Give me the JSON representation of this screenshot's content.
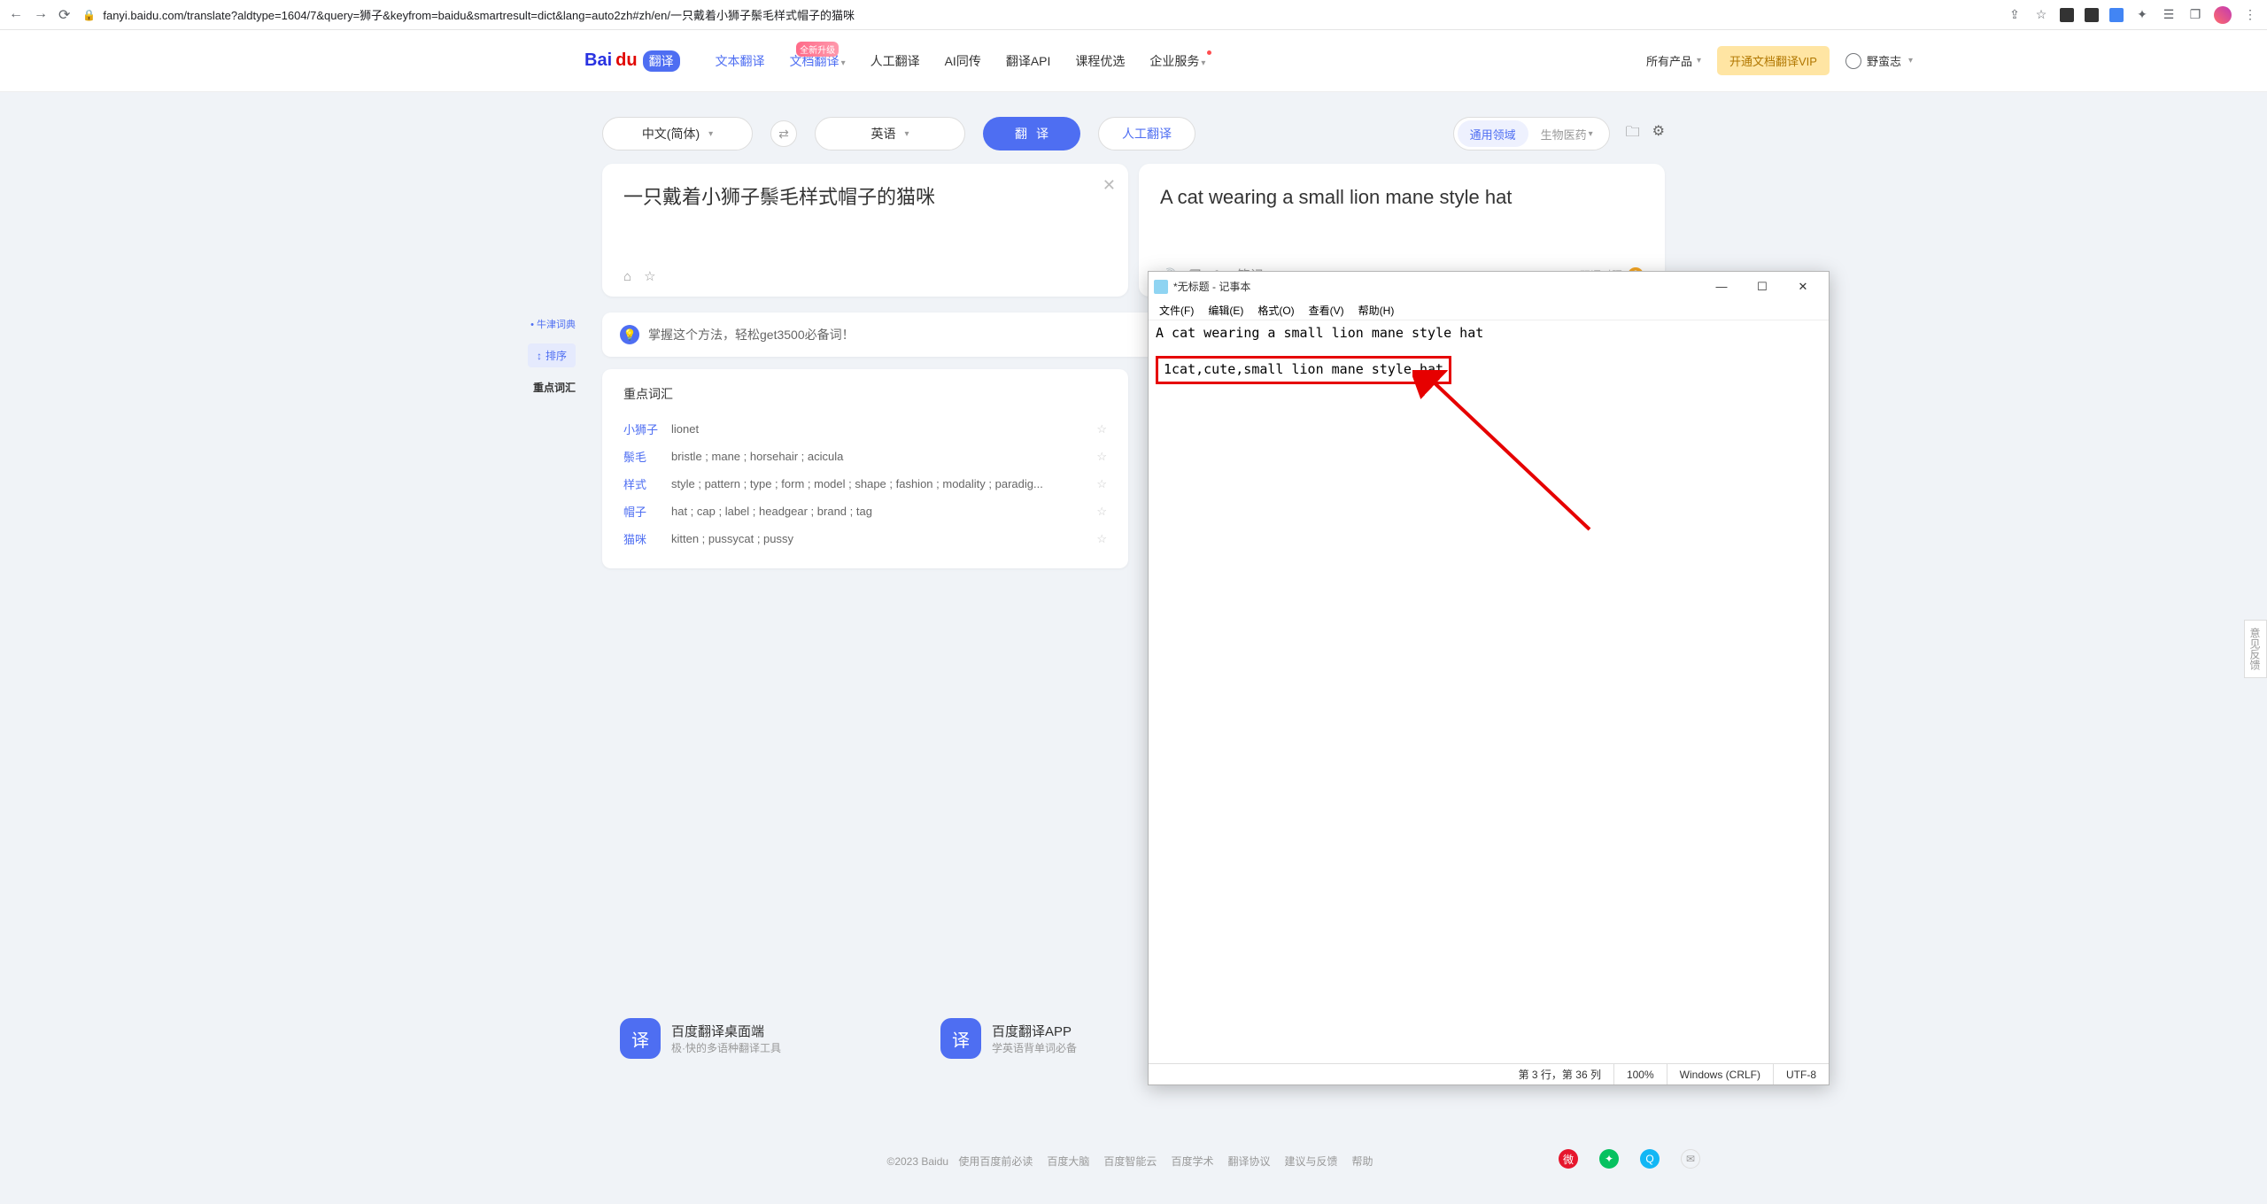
{
  "browser": {
    "url": "fanyi.baidu.com/translate?aldtype=1604/7&query=狮子&keyfrom=baidu&smartresult=dict&lang=auto2zh#zh/en/一只戴着小狮子鬃毛样式帽子的猫咪"
  },
  "header": {
    "logo_left": "Bai",
    "logo_right": "du",
    "logo_badge": "翻译",
    "nav": {
      "text": "文本翻译",
      "doc": "文档翻译",
      "doc_badge": "全新升级",
      "human": "人工翻译",
      "ai": "AI同传",
      "api": "翻译API",
      "course": "课程优选",
      "enterprise": "企业服务"
    },
    "all_products": "所有产品",
    "vip": "开通文档翻译VIP",
    "username": "野蛮志"
  },
  "translate": {
    "src_lang": "中文(简体)",
    "dst_lang": "英语",
    "translate_btn": "翻译",
    "human_btn": "人工翻译",
    "domain_general": "通用领域",
    "domain_bio": "生物医药",
    "src_text": "一只戴着小狮子鬃毛样式帽子的猫咪",
    "dst_text": "A cat wearing a small lion mane style hat",
    "dual_label": "双语对照",
    "notes_label": "笔记"
  },
  "side": {
    "sentence": "牛津词典",
    "sort": "排序",
    "key": "重点词汇"
  },
  "tip": "掌握这个方法，轻松get3500必备词！",
  "vocab": {
    "title": "重点词汇",
    "rows": [
      {
        "term": "小狮子",
        "defs": "lionet"
      },
      {
        "term": "鬃毛",
        "defs": "bristle ; mane ; horsehair ; acicula"
      },
      {
        "term": "样式",
        "defs": "style ; pattern ; type ; form ; model ; shape ; fashion ; modality ; paradig..."
      },
      {
        "term": "帽子",
        "defs": "hat ; cap ; label ; headgear ; brand ; tag"
      },
      {
        "term": "猫咪",
        "defs": "kitten ; pussycat ; pussy"
      }
    ]
  },
  "promo": {
    "desktop_title": "百度翻译桌面端",
    "desktop_sub": "极·快的多语种翻译工具",
    "app_title": "百度翻译APP",
    "app_sub": "学英语背单词必备"
  },
  "footer": {
    "copyright": "©2023 Baidu",
    "links": [
      "使用百度前必读",
      "百度大脑",
      "百度智能云",
      "百度学术",
      "翻译协议",
      "建议与反馈",
      "帮助"
    ]
  },
  "feedback": "意见反馈",
  "notepad": {
    "title": "*无标题 - 记事本",
    "menus": [
      "文件(F)",
      "编辑(E)",
      "格式(O)",
      "查看(V)",
      "帮助(H)"
    ],
    "line1": "A cat wearing a small lion mane style hat",
    "line2": "1cat,cute,small lion mane style hat",
    "status_pos": "第 3 行，第 36 列",
    "status_zoom": "100%",
    "status_eol": "Windows (CRLF)",
    "status_enc": "UTF-8"
  }
}
